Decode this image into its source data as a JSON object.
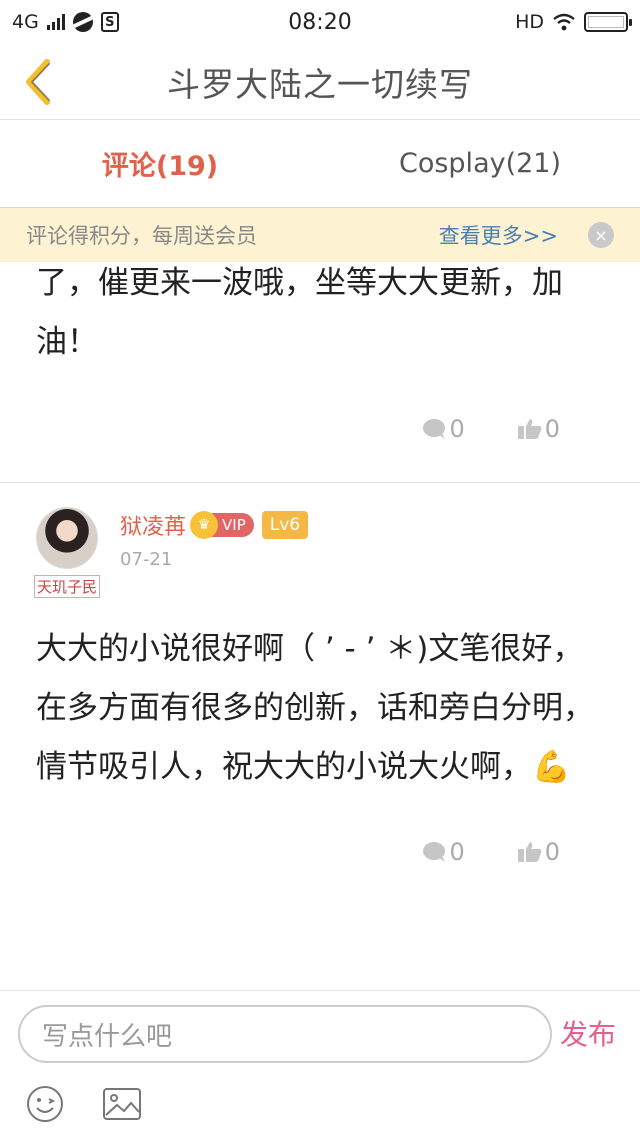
{
  "status_bar": {
    "network": "4G",
    "time": "08:20",
    "hd": "HD",
    "s_icon": "S"
  },
  "header": {
    "title": "斗罗大陆之一切续写"
  },
  "tabs": [
    {
      "label": "评论(19)",
      "active": true
    },
    {
      "label": "Cosplay(21)",
      "active": false
    }
  ],
  "notice": {
    "text": "评论得积分，每周送会员",
    "link": "查看更多>>",
    "close": "×"
  },
  "comments": [
    {
      "text": "了，催更来一波哦，坐等大大更新，加油！",
      "reply_count": "0",
      "like_count": "0"
    },
    {
      "username": "狱凌苒",
      "vip": "VIP",
      "level": "Lv6",
      "date": "07-21",
      "tag": "天玑子民",
      "text": "大大的小说很好啊（ ’ - ’ ＊)文笔很好，在多方面有很多的创新，话和旁白分明，情节吸引人，祝大大的小说大火啊，💪",
      "reply_count": "0",
      "like_count": "0"
    }
  ],
  "composer": {
    "placeholder": "写点什么吧",
    "send_label": "发布"
  },
  "colors": {
    "accent": "#e2614a",
    "send": "#e4608a",
    "link": "#4a7fb0",
    "notice_bg": "#fdf3d2"
  }
}
